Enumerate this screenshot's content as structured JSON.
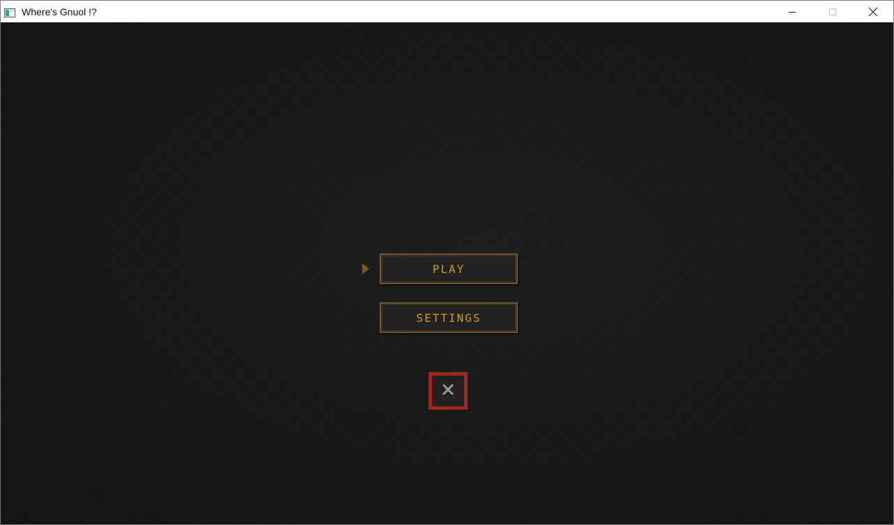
{
  "window": {
    "title": "Where's Gnuol !?",
    "controls": [
      "minimize-icon",
      "maximize-icon",
      "close-icon"
    ]
  },
  "menu": {
    "selected_index": 0,
    "buttons": [
      {
        "label": "PLAY"
      },
      {
        "label": "SETTINGS"
      }
    ],
    "quit_icon": "x-icon"
  },
  "colors": {
    "background": "#1d1d1d",
    "button_border": "#6e5a2c",
    "button_text": "#c99a36",
    "quit_border": "#9a2a1e",
    "selector": "#8a6a2a"
  }
}
